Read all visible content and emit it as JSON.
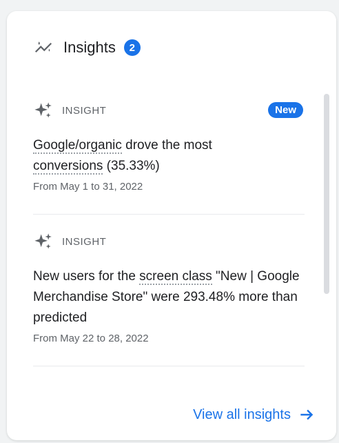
{
  "header": {
    "title": "Insights",
    "count": "2"
  },
  "insights": [
    {
      "tag": "INSIGHT",
      "badge": "New",
      "text_parts": [
        "Google/organic",
        " drove the most ",
        "conversions",
        " (35.33%)"
      ],
      "date": "From May 1 to 31, 2022"
    },
    {
      "tag": "INSIGHT",
      "text_parts": [
        "New users for the ",
        "screen class",
        " \"New | Google Merchandise Store\" were 293.48% more than predicted"
      ],
      "date": "From May 22 to 28, 2022"
    }
  ],
  "footer": {
    "view_all": "View all insights"
  },
  "colors": {
    "accent": "#1a73e8",
    "text": "#202124",
    "muted": "#5f6368"
  }
}
